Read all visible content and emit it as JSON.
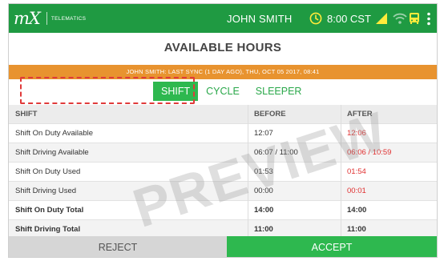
{
  "header": {
    "logo_text": "mX",
    "logo_subtext": "TELEMATICS",
    "user": "JOHN SMITH",
    "time": "8:00 CST",
    "icons": [
      "clock-icon",
      "signal-icon",
      "wifi-icon",
      "bus-icon",
      "menu-icon"
    ]
  },
  "title": "AVAILABLE HOURS",
  "sync_text": "JOHN SMITH: LAST SYNC (1 DAY AGO), THU, OCT 05 2017, 08:41",
  "tabs": [
    {
      "label": "SHIFT",
      "active": true
    },
    {
      "label": "CYCLE",
      "active": false
    },
    {
      "label": "SLEEPER",
      "active": false
    }
  ],
  "table": {
    "headers": [
      "SHIFT",
      "BEFORE",
      "AFTER"
    ],
    "rows": [
      {
        "label": "Shift On Duty Available",
        "before": "12:07",
        "after": "12:06"
      },
      {
        "label": "Shift Driving Available",
        "before": "06:07 / 11:00",
        "after": "06:06 / 10:59"
      },
      {
        "label": "Shift On Duty Used",
        "before": "01:53",
        "after": "01:54"
      },
      {
        "label": "Shift Driving Used",
        "before": "00:00",
        "after": "00:01"
      },
      {
        "label": "Shift On Duty Total",
        "before": "14:00",
        "after": "14:00"
      },
      {
        "label": "Shift Driving Total",
        "before": "11:00",
        "after": "11:00"
      }
    ]
  },
  "watermark": "PREVIEW",
  "buttons": {
    "reject": "REJECT",
    "accept": "ACCEPT"
  },
  "colors": {
    "primary_green": "#2eb84f",
    "sync_orange": "#e8932f",
    "changed_red": "#e03030",
    "highlight_dash": "#e03a3a"
  }
}
